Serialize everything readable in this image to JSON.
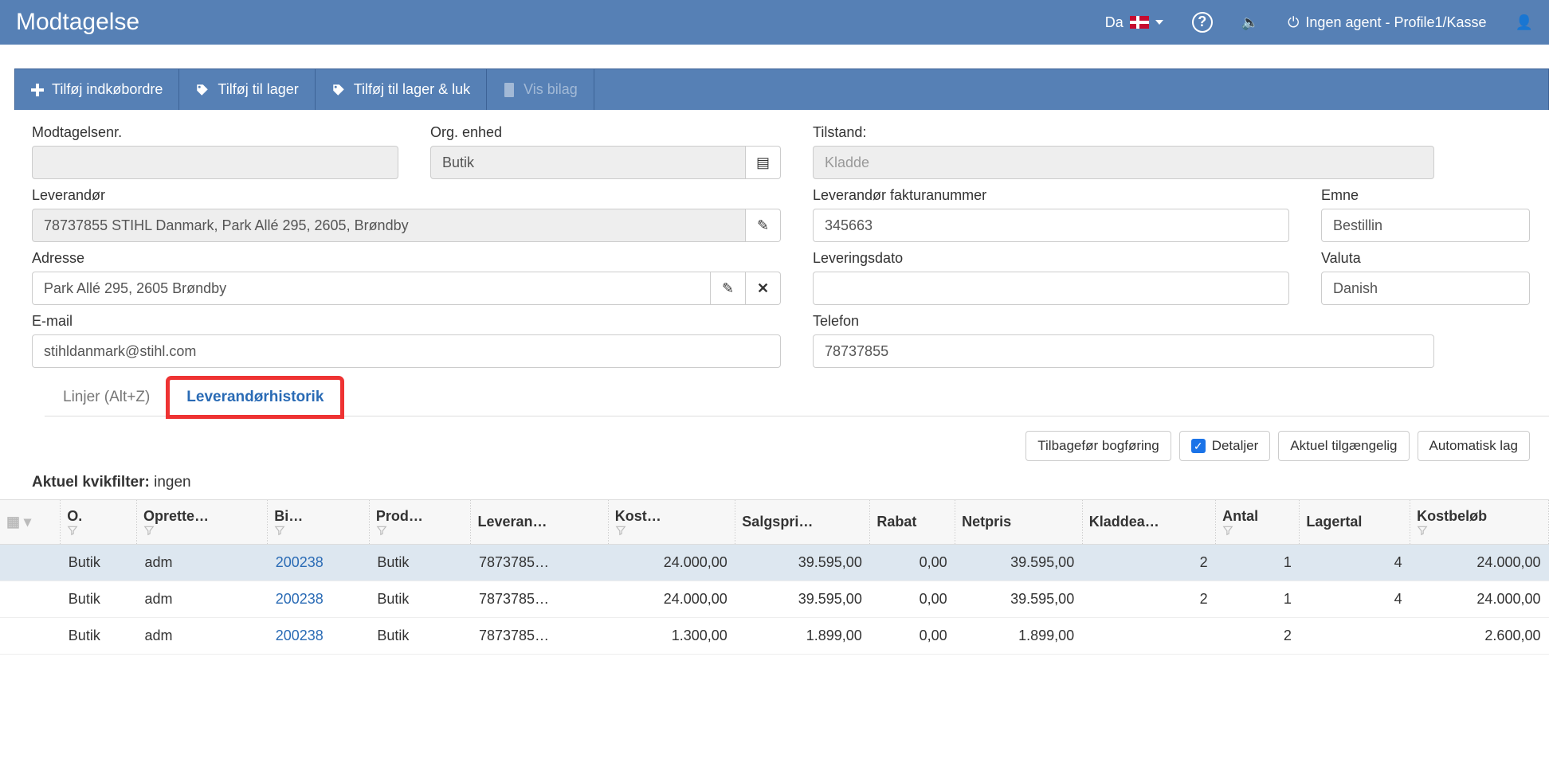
{
  "header": {
    "title": "Modtagelse",
    "lang": "Da",
    "agent": "Ingen agent - Profile1/Kasse"
  },
  "toolbar": {
    "add_po": "Tilføj indkøbordre",
    "add_stock": "Tilføj til lager",
    "add_stock_close": "Tilføj til lager & luk",
    "show_attach": "Vis bilag"
  },
  "fields": {
    "modtagelsenr_label": "Modtagelsenr.",
    "modtagelsenr": "",
    "org_label": "Org. enhed",
    "org": "Butik",
    "tilstand_label": "Tilstand:",
    "tilstand": "Kladde",
    "lev_label": "Leverandør",
    "lev": "78737855 STIHL Danmark, Park Allé 295, 2605, Brøndby",
    "lev_faktura_label": "Leverandør fakturanummer",
    "lev_faktura": "345663",
    "emne_label": "Emne",
    "emne": "Bestillin",
    "adresse_label": "Adresse",
    "adresse": "Park Allé 295, 2605 Brøndby",
    "leveringsdato_label": "Leveringsdato",
    "leveringsdato": "",
    "valuta_label": "Valuta",
    "valuta": "Danish",
    "email_label": "E-mail",
    "email": "stihldanmark@stihl.com",
    "telefon_label": "Telefon",
    "telefon": "78737855"
  },
  "tabs": {
    "linjer": "Linjer (Alt+Z)",
    "historik": "Leverandørhistorik"
  },
  "actions": {
    "tilbagefoer": "Tilbagefør bogføring",
    "detaljer": "Detaljer",
    "aktuel": "Aktuel tilgængelig",
    "autolag": "Automatisk lag"
  },
  "filter": {
    "prefix": "Aktuel kvikfilter:",
    "value": "ingen"
  },
  "columns": [
    "O.",
    "Oprette…",
    "Bi…",
    "Prod…",
    "Leveran…",
    "Kost…",
    "Salgspri…",
    "Rabat",
    "Netpris",
    "Kladdea…",
    "Antal",
    "Lagertal",
    "Kostbeløb"
  ],
  "rows": [
    {
      "o": "Butik",
      "opr": "adm",
      "bi": "200238",
      "prod": "Butik",
      "lev": "7873785…",
      "kost": "24.000,00",
      "salg": "39.595,00",
      "rabat": "0,00",
      "net": "39.595,00",
      "kladde": "2",
      "antal": "1",
      "lager": "4",
      "kostb": "24.000,00"
    },
    {
      "o": "Butik",
      "opr": "adm",
      "bi": "200238",
      "prod": "Butik",
      "lev": "7873785…",
      "kost": "24.000,00",
      "salg": "39.595,00",
      "rabat": "0,00",
      "net": "39.595,00",
      "kladde": "2",
      "antal": "1",
      "lager": "4",
      "kostb": "24.000,00"
    },
    {
      "o": "Butik",
      "opr": "adm",
      "bi": "200238",
      "prod": "Butik",
      "lev": "7873785…",
      "kost": "1.300,00",
      "salg": "1.899,00",
      "rabat": "0,00",
      "net": "1.899,00",
      "kladde": "",
      "antal": "2",
      "lager": "",
      "kostb": "2.600,00"
    }
  ]
}
